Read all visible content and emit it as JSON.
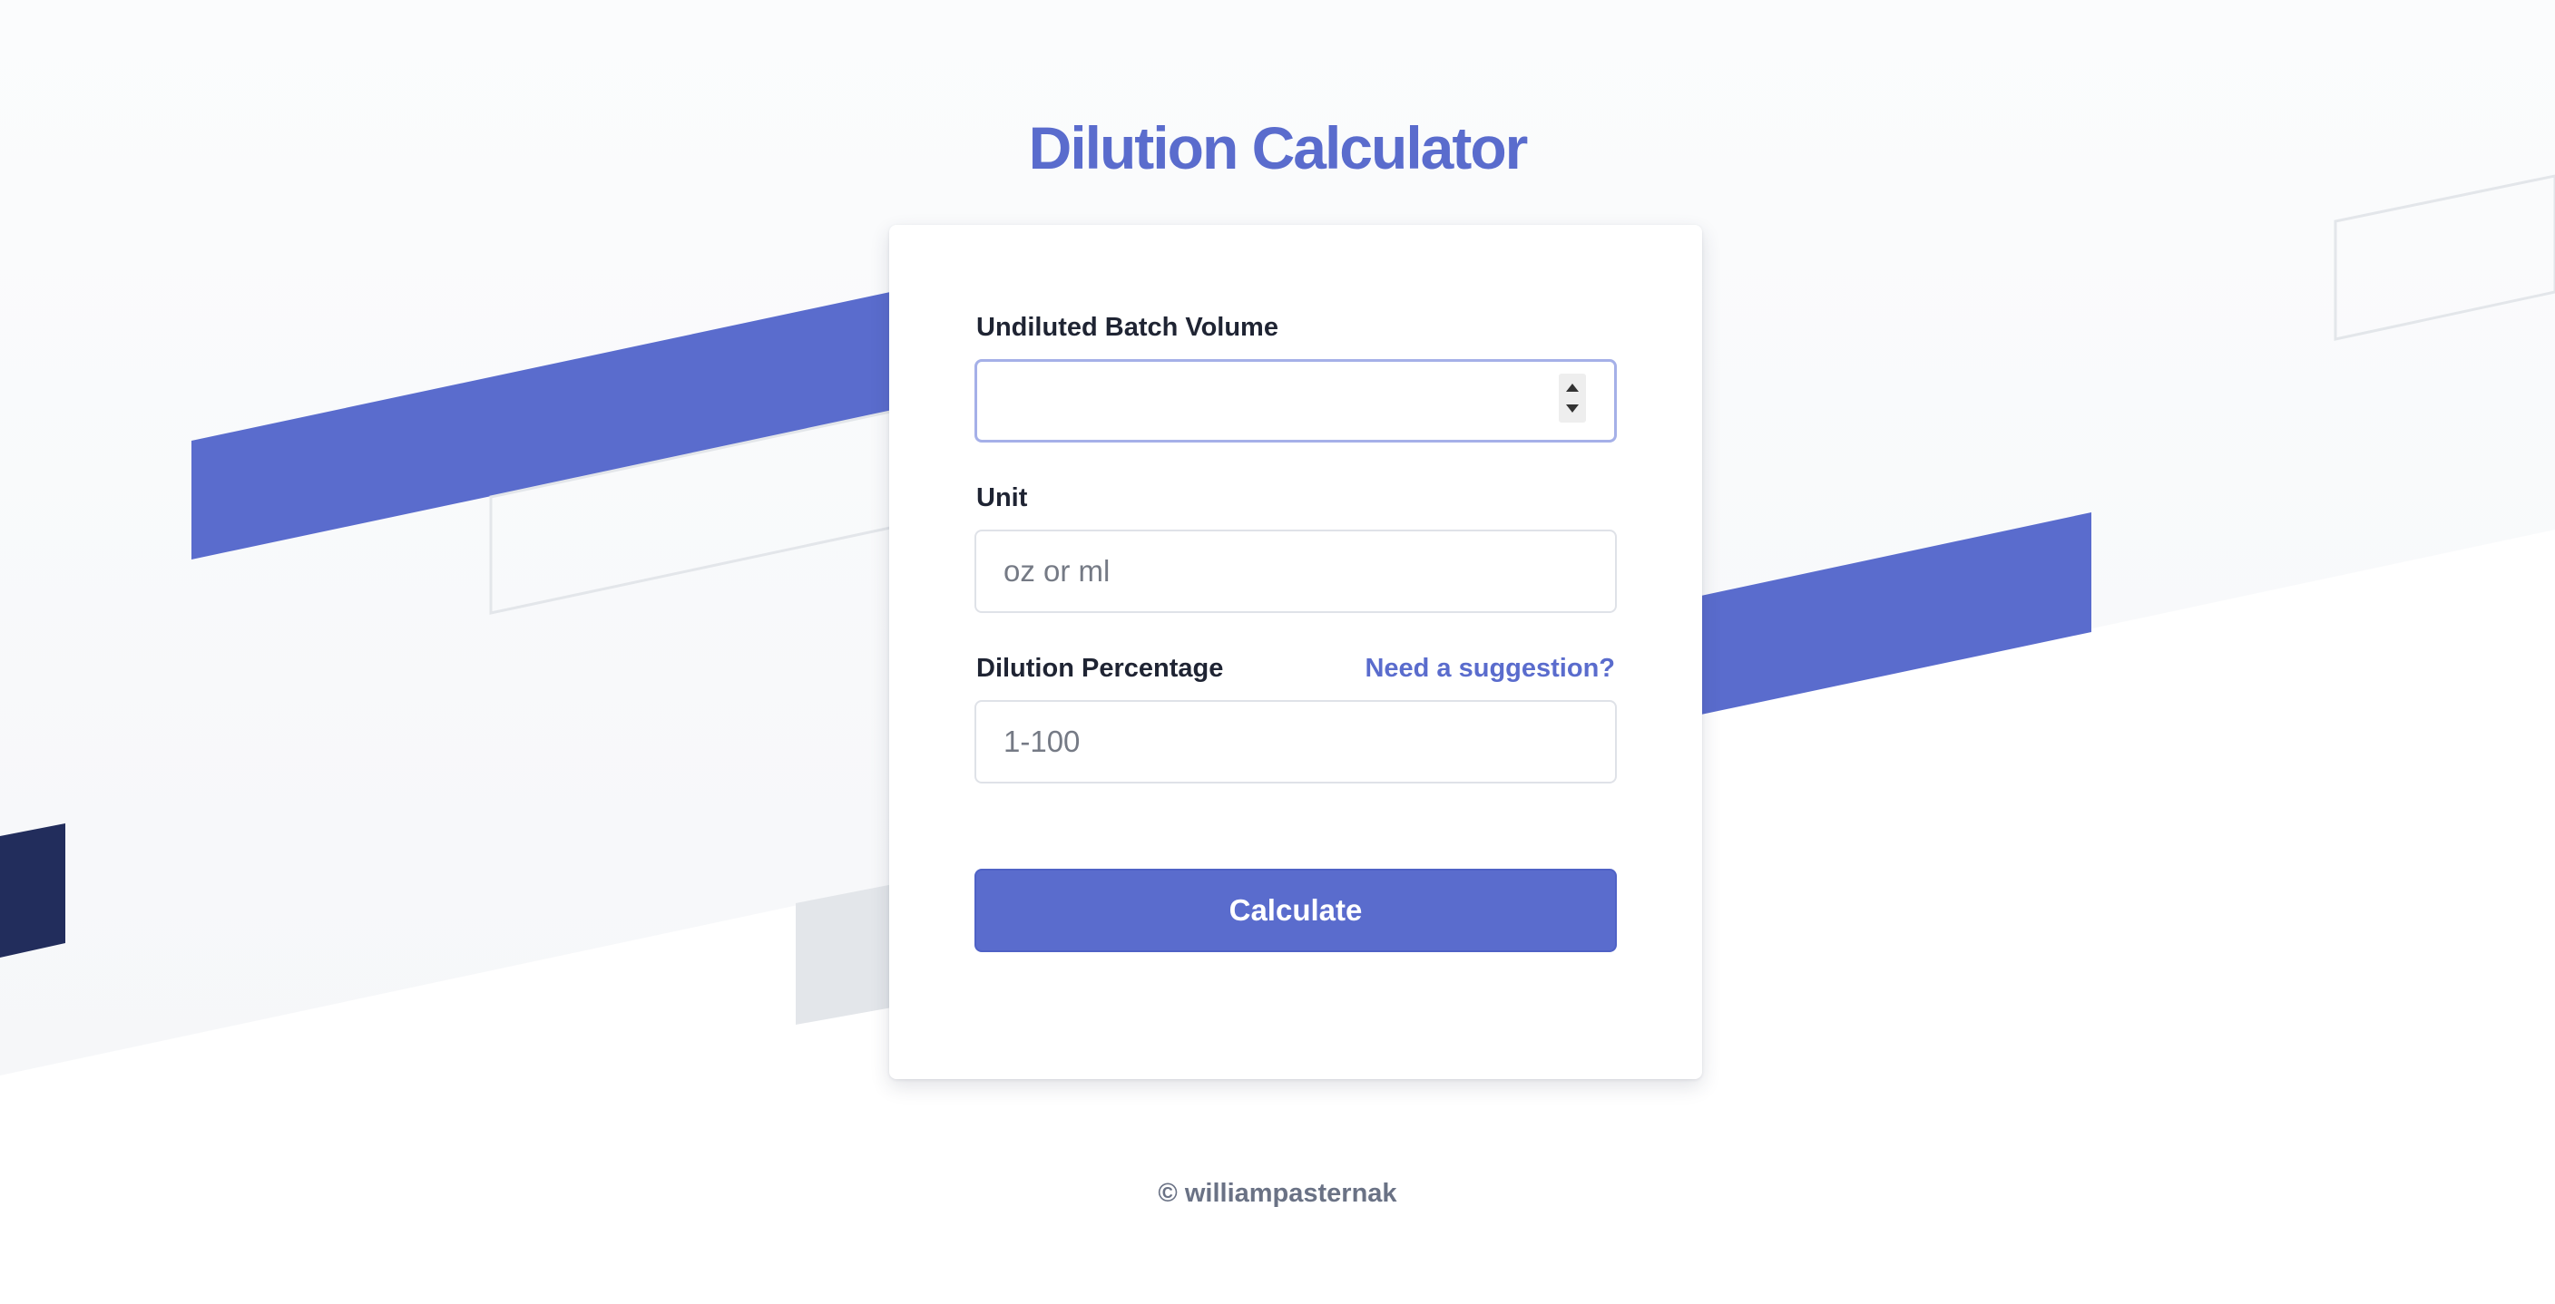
{
  "page": {
    "title": "Dilution Calculator",
    "footer": "© williampasternak"
  },
  "form": {
    "batch_volume": {
      "label": "Undiluted Batch Volume",
      "value": "",
      "placeholder": ""
    },
    "unit": {
      "label": "Unit",
      "value": "",
      "placeholder": "oz or ml"
    },
    "dilution": {
      "label": "Dilution Percentage",
      "value": "",
      "placeholder": "1-100",
      "suggestion_link": "Need a suggestion?"
    },
    "submit_label": "Calculate"
  },
  "colors": {
    "accent": "#5a6ccd",
    "navy": "#222d5c",
    "background": "#f8f9fb",
    "text": "#1f2433",
    "muted": "#6a7285"
  },
  "icons": {
    "spinner_up": "triangle-up",
    "spinner_down": "triangle-down"
  }
}
